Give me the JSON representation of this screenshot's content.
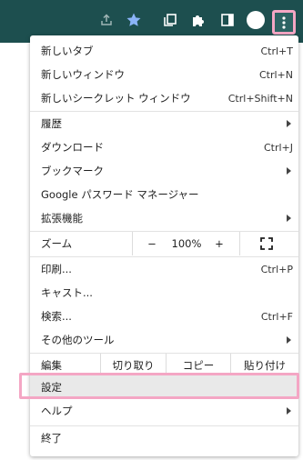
{
  "menu": {
    "new_tab": {
      "label": "新しいタブ",
      "shortcut": "Ctrl+T"
    },
    "new_window": {
      "label": "新しいウィンドウ",
      "shortcut": "Ctrl+N"
    },
    "new_incognito": {
      "label": "新しいシークレット ウィンドウ",
      "shortcut": "Ctrl+Shift+N"
    },
    "history": {
      "label": "履歴"
    },
    "downloads": {
      "label": "ダウンロード",
      "shortcut": "Ctrl+J"
    },
    "bookmarks": {
      "label": "ブックマーク"
    },
    "password_manager": {
      "label": "Google パスワード マネージャー"
    },
    "extensions": {
      "label": "拡張機能"
    },
    "zoom": {
      "label": "ズーム",
      "minus": "−",
      "value": "100%",
      "plus": "+"
    },
    "print": {
      "label": "印刷...",
      "shortcut": "Ctrl+P"
    },
    "cast": {
      "label": "キャスト..."
    },
    "find": {
      "label": "検索...",
      "shortcut": "Ctrl+F"
    },
    "more_tools": {
      "label": "その他のツール"
    },
    "edit": {
      "label": "編集",
      "cut": "切り取り",
      "copy": "コピー",
      "paste": "貼り付け"
    },
    "settings": {
      "label": "設定"
    },
    "help": {
      "label": "ヘルプ"
    },
    "exit": {
      "label": "終了"
    }
  },
  "colors": {
    "toolbar_bg": "#1d4f4f",
    "highlight": "#f4a6c4",
    "star": "#8ab4f8"
  },
  "icons": [
    "share-icon",
    "star-icon",
    "tab-search-icon",
    "extensions-icon",
    "side-panel-icon",
    "profile-icon",
    "more-vert-icon"
  ]
}
